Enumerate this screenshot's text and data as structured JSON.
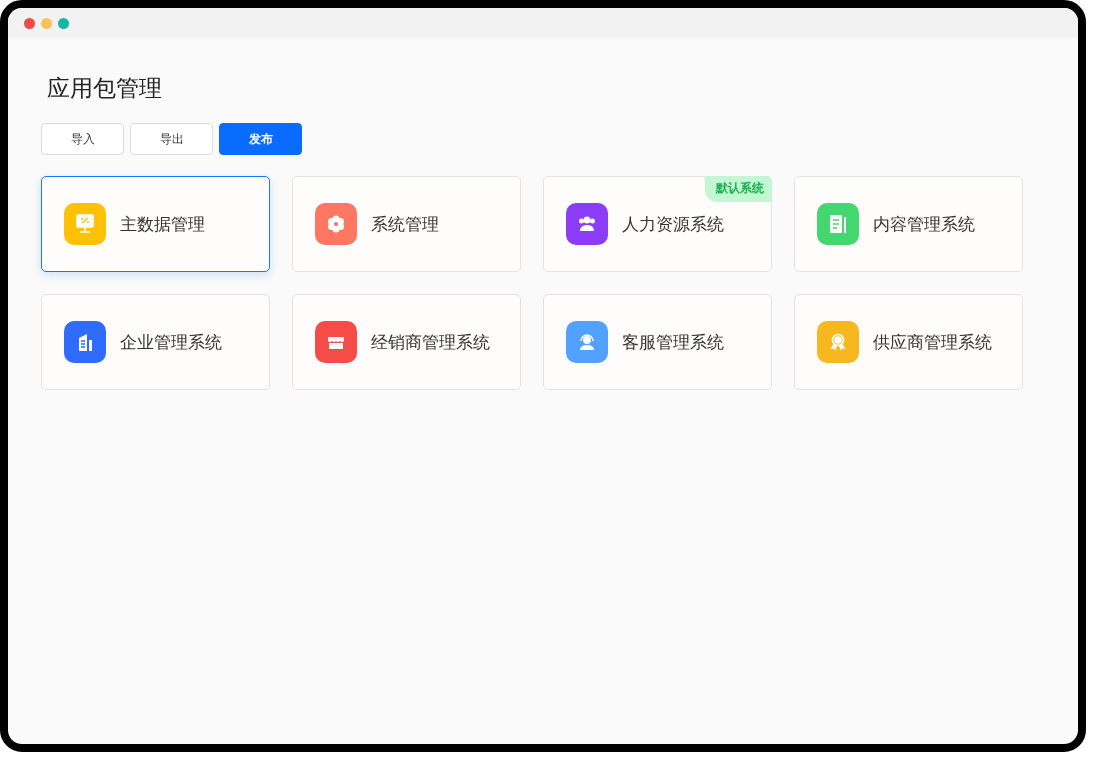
{
  "page": {
    "title": "应用包管理"
  },
  "buttons": [
    {
      "label": "导入",
      "kind": "default"
    },
    {
      "label": "导出",
      "kind": "default"
    },
    {
      "label": "发布",
      "kind": "primary"
    }
  ],
  "apps": [
    {
      "name": "主数据管理",
      "color": "#ffc107",
      "selected": true
    },
    {
      "name": "系统管理",
      "color": "#ff7761",
      "selected": false
    },
    {
      "name": "人力资源系统",
      "color": "#8b3cf7",
      "selected": false,
      "badge": "默认系统"
    },
    {
      "name": "内容管理系统",
      "color": "#43d86f",
      "selected": false
    },
    {
      "name": "企业管理系统",
      "color": "#2f6bff",
      "selected": false
    },
    {
      "name": "经销商管理系统",
      "color": "#f64c47",
      "selected": false
    },
    {
      "name": "客服管理系统",
      "color": "#52a0ff",
      "selected": false
    },
    {
      "name": "供应商管理系统",
      "color": "#f7b81f",
      "selected": false
    }
  ]
}
